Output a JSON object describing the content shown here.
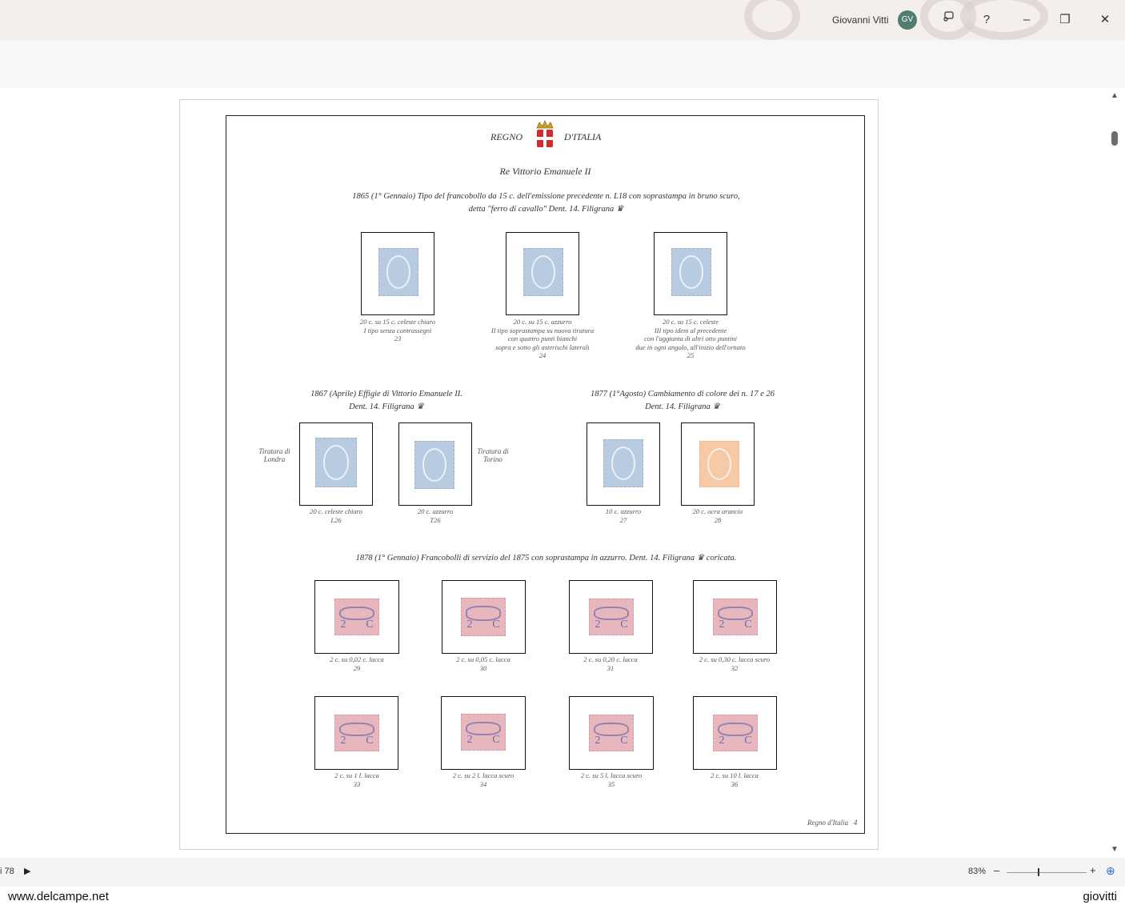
{
  "titlebar": {
    "user_name": "Giovanni Vitti",
    "avatar_initials": "GV",
    "help_label": "?",
    "minimize_label": "–",
    "restore_label": "❐",
    "close_label": "✕",
    "feedback_icon": "feedback-icon"
  },
  "document": {
    "header_left": "REGNO",
    "header_right": "D'ITALIA",
    "title": "Re Vittorio Emanuele II",
    "section1": {
      "line1": "1865 (1° Gennaio) Tipo del francobollo da 15 c. dell'emissione precedente n. L18 con soprastampa in bruno scuro,",
      "line2": "detta \"ferro di cavallo\" Dent. 14. Filigrana",
      "stamps": [
        {
          "cap1": "20 c. su 15 c. celeste chiaro",
          "cap2": "I tipo senza contrassegni",
          "cap3": "23",
          "cap4": "",
          "cap5": ""
        },
        {
          "cap1": "20 c. su 15 c. azzurro",
          "cap2": "II tipo soprastampa su nuova tiratura",
          "cap3": "con quattro punti bianchi",
          "cap4": "sopra e sotto gli asterischi laterali",
          "cap5": "24"
        },
        {
          "cap1": "20 c. su 15 c. celeste",
          "cap2": "III tipo idem al precedente",
          "cap3": "con l'aggiunta di altri otto puntini",
          "cap4": "due in ogni angolo, all'inizio dell'ornato",
          "cap5": "25"
        }
      ]
    },
    "section2": {
      "line1": "1867 (Aprile) Effigie di Vittorio Emanuele II.",
      "line2": "Dent. 14. Filigrana",
      "side_left": "Tiratura di Londra",
      "side_right": "Tiratura di Torino",
      "stamps": [
        {
          "cap1": "20 c. celeste chiaro",
          "cap2": "L26"
        },
        {
          "cap1": "20 c. azzurro",
          "cap2": "T26"
        }
      ]
    },
    "section3": {
      "line1": "1877 (1°Agosto) Cambiamento di colore dei n. 17 e 26",
      "line2": "Dent. 14. Filigrana",
      "stamps": [
        {
          "cap1": "10 c. azzurro",
          "cap2": "27"
        },
        {
          "cap1": "20 c. ocra arancio",
          "cap2": "28"
        }
      ]
    },
    "section4": {
      "line1": "1878 (1° Gennaio) Francobolli di servizio del 1875 con soprastampa in azzurro. Dent. 14. Filigrana",
      "line1_end": "coricata.",
      "row1": [
        {
          "cap1": "2 c. su 0,02 c. lacca",
          "cap2": "29"
        },
        {
          "cap1": "2 c. su 0,05 c. lacca",
          "cap2": "30"
        },
        {
          "cap1": "2 c. su 0,20 c. lacca",
          "cap2": "31"
        },
        {
          "cap1": "2 c. su 0,30 c. lacca scuro",
          "cap2": "32"
        }
      ],
      "row2": [
        {
          "cap1": "2 c. su 1 l. lacca",
          "cap2": "33"
        },
        {
          "cap1": "2 c. su 2 l. lacca scuro",
          "cap2": "34"
        },
        {
          "cap1": "2 c. su 5 l. lacca scuro",
          "cap2": "35"
        },
        {
          "cap1": "2 c. su 10 l. lacca",
          "cap2": "36"
        }
      ]
    },
    "footer": "Regno d'Italia   4",
    "crown_symbol": "♛"
  },
  "statusbar": {
    "page_of": "i 78",
    "zoom": "83%",
    "zoom_minus": "–",
    "zoom_plus": "+",
    "play_icon": "▶",
    "fit_icon": "⊕"
  },
  "watermark": {
    "left": "www.delcampe.net",
    "right": "giovitti"
  }
}
